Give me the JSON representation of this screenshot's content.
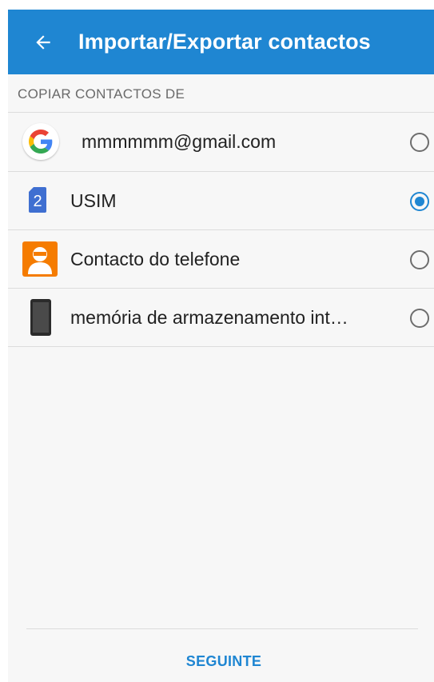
{
  "app_bar": {
    "title": "Importar/Exportar contactos",
    "back_icon": "arrow-left-icon",
    "background_color": "#1f86d2"
  },
  "section": {
    "header": "COPIAR CONTACTOS DE"
  },
  "sources": [
    {
      "label": "mmmmmm@gmail.com",
      "icon": "google-icon",
      "selected": false
    },
    {
      "label": "USIM",
      "icon": "sim-2-icon",
      "icon_text": "2",
      "selected": true
    },
    {
      "label": "Contacto do telefone",
      "icon": "phone-contact-icon",
      "selected": false
    },
    {
      "label": "memória de armazenamento int…",
      "icon": "device-storage-icon",
      "selected": false
    }
  ],
  "footer": {
    "next_label": "SEGUINTE"
  },
  "accent_color": "#1f86d2"
}
